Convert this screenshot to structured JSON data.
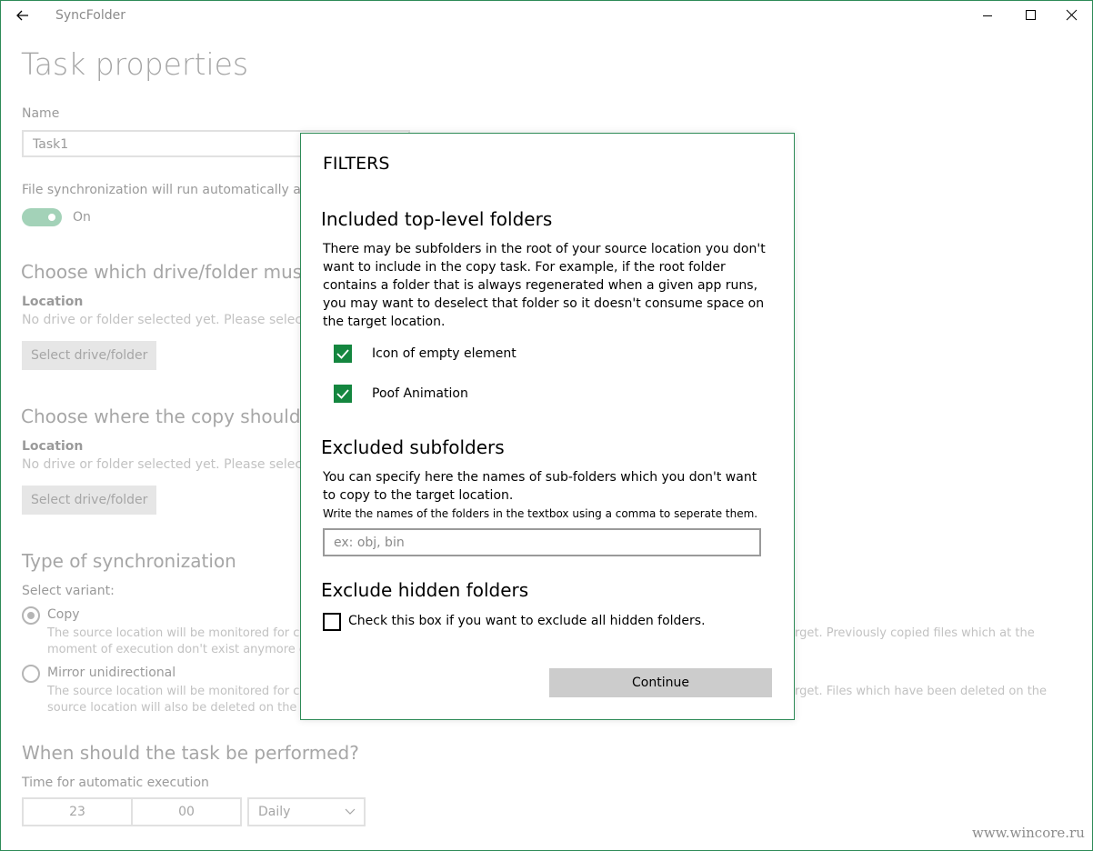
{
  "window": {
    "app_title": "SyncFolder"
  },
  "page": {
    "title": "Task properties",
    "name_label": "Name",
    "name_value": "Task1",
    "auto_run_text": "File synchronization will run automatically at th",
    "toggle_label": "On",
    "source_section_title": "Choose which drive/folder must be",
    "source_location_label": "Location",
    "source_location_hint": "No drive or folder selected yet. Please select o",
    "source_select_button": "Select drive/folder",
    "target_section_title": "Choose where the copy should be s",
    "target_location_label": "Location",
    "target_location_hint": "No drive or folder selected yet. Please select o",
    "target_select_button": "Select drive/folder",
    "sync_type_title": "Type of synchronization",
    "select_variant_label": "Select variant:",
    "variant_copy": {
      "label": "Copy",
      "desc_line1_left": "The source location will be monitored for cha",
      "desc_line1_right": "rget. Previously copied files which at the",
      "desc_line2_left": "moment of execution don't exist anymore on"
    },
    "variant_mirror": {
      "label": "Mirror unidirectional",
      "desc_line1_left": "The source location will be monitored for cha",
      "desc_line1_right": "rget. Files which have been deleted on the",
      "desc_line2_left": "source location will also be deleted on the ta"
    },
    "schedule_title": "When should the task be performed?",
    "time_label": "Time for automatic execution",
    "hour": "23",
    "minute": "00",
    "frequency": "Daily"
  },
  "dialog": {
    "title": "FILTERS",
    "included_heading": "Included top-level folders",
    "included_text": "There may be subfolders in the root of your source location you don't want to include in the copy task. For example, if the root folder contains a folder that is always regenerated when a given app runs, you may want to deselect that folder so it doesn't consume space on the target location.",
    "folders": [
      {
        "label": "Icon of empty element",
        "checked": true
      },
      {
        "label": "Poof Animation",
        "checked": true
      }
    ],
    "excluded_heading": "Excluded subfolders",
    "excluded_text": "You can specify here the names of sub-folders which you don't want to copy to the target location.",
    "excluded_note": "Write the names of the folders in the textbox using a comma to seperate them.",
    "excluded_placeholder": "ex: obj, bin",
    "hidden_heading": "Exclude hidden folders",
    "hidden_checkbox_label": "Check this box if you want to exclude all hidden folders.",
    "continue_label": "Continue"
  },
  "watermark": "www.wincore.ru",
  "colors": {
    "accent": "#14863f",
    "frame": "#2e8b57",
    "button_gray": "#cccccc"
  }
}
